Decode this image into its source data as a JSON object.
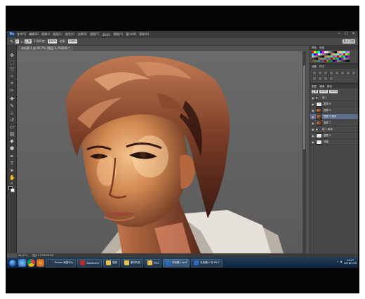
{
  "menubar": {
    "app_icon": "Ps",
    "items": [
      "文件(F)",
      "编辑(E)",
      "图像(I)",
      "图层(L)",
      "类型(Y)",
      "选择(S)",
      "滤镜(T)",
      "3D(D)",
      "视图(V)",
      "窗口(W)",
      "帮助(H)"
    ],
    "window_controls": [
      "─",
      "□",
      "✕"
    ]
  },
  "options": {
    "size": "2",
    "mode": "正常",
    "opacity_label": "不透明度:",
    "opacity": "100%",
    "flow_label": "流量:",
    "flow": "100%",
    "workspace": "基本功能"
  },
  "document": {
    "tab": "未标题-1 @ 66.7% (图层 3, RGB/8) *"
  },
  "status": {
    "zoom": "66.67%",
    "doc_size": "文档:4.12M/26.5M"
  },
  "panels": {
    "swatch_tabs": [
      "颜色",
      "色板"
    ],
    "adjust_tabs": [
      "调整",
      "样式"
    ],
    "layer_tabs": [
      "图层",
      "通道",
      "路径"
    ],
    "blend_mode": "正常",
    "opacity": "100%",
    "fill": "100%",
    "layers": [
      {
        "name": "组 1",
        "kind": "folder",
        "active": false
      },
      {
        "name": "图层 6",
        "kind": "plain",
        "active": false
      },
      {
        "name": "图层 5",
        "kind": "img",
        "active": false
      },
      {
        "name": "图层 3 副本",
        "kind": "img",
        "active": true
      },
      {
        "name": "图层 3",
        "kind": "img",
        "active": false
      },
      {
        "name": "组 2 副本",
        "kind": "folder",
        "active": false
      },
      {
        "name": "图层 2",
        "kind": "plain",
        "active": false
      },
      {
        "name": "背景",
        "kind": "plain",
        "active": false
      }
    ]
  },
  "taskbar": {
    "items": [
      {
        "label": "Steam 家庭中心",
        "color": "#2a3b4f",
        "active": false
      },
      {
        "label": "Bandicam",
        "color": "#c0282e",
        "active": false
      },
      {
        "label": "视频",
        "color": "#e8c04a",
        "active": false
      },
      {
        "label": "素材作品",
        "color": "#e8c04a",
        "active": false
      },
      {
        "label": "PSD",
        "color": "#e8c04a",
        "active": false
      },
      {
        "label": "未标题-1.psd",
        "color": "#2a6ac0",
        "active": true
      },
      {
        "label": "未标题-2 @ 66.7",
        "color": "#2a6ac0",
        "active": false
      }
    ],
    "time": "14:27",
    "date": "2016/1/20"
  },
  "colors": {
    "accent": "#5d6f88",
    "canvas_bg": "#5f5f5f",
    "taskbar": "#12304d"
  }
}
